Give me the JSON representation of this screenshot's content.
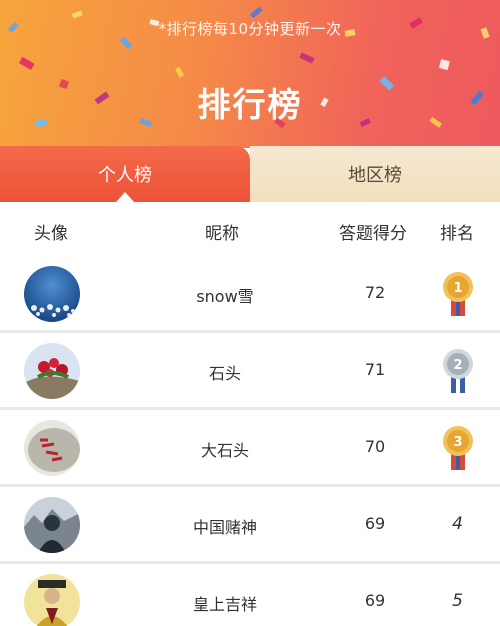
{
  "banner": {
    "notice": "*排行榜每10分钟更新一次",
    "title": "排行榜"
  },
  "tabs": [
    {
      "label": "个人榜",
      "active": true
    },
    {
      "label": "地区榜",
      "active": false
    }
  ],
  "table": {
    "columns": [
      "头像",
      "昵称",
      "答题得分",
      "排名"
    ],
    "rows": [
      {
        "nickname": "snow雪",
        "score": "72",
        "rank": "1",
        "medal": "gold-medal-icon"
      },
      {
        "nickname": "石头",
        "score": "71",
        "rank": "2",
        "medal": "silver-medal-icon"
      },
      {
        "nickname": "大石头",
        "score": "70",
        "rank": "3",
        "medal": "bronze-medal-icon"
      },
      {
        "nickname": "中国赌神",
        "score": "69",
        "rank": "4"
      },
      {
        "nickname": "皇上吉祥",
        "score": "69",
        "rank": "5"
      }
    ]
  },
  "colors": {
    "banner_start": "#f6a53c",
    "banner_end": "#ee5a5f",
    "tab_active": "#ee5237",
    "tab_inactive": "#f2dfbf",
    "gold": "#e7a531",
    "silver": "#a7b0ba",
    "medal_ribbon": "#d94a3b"
  }
}
